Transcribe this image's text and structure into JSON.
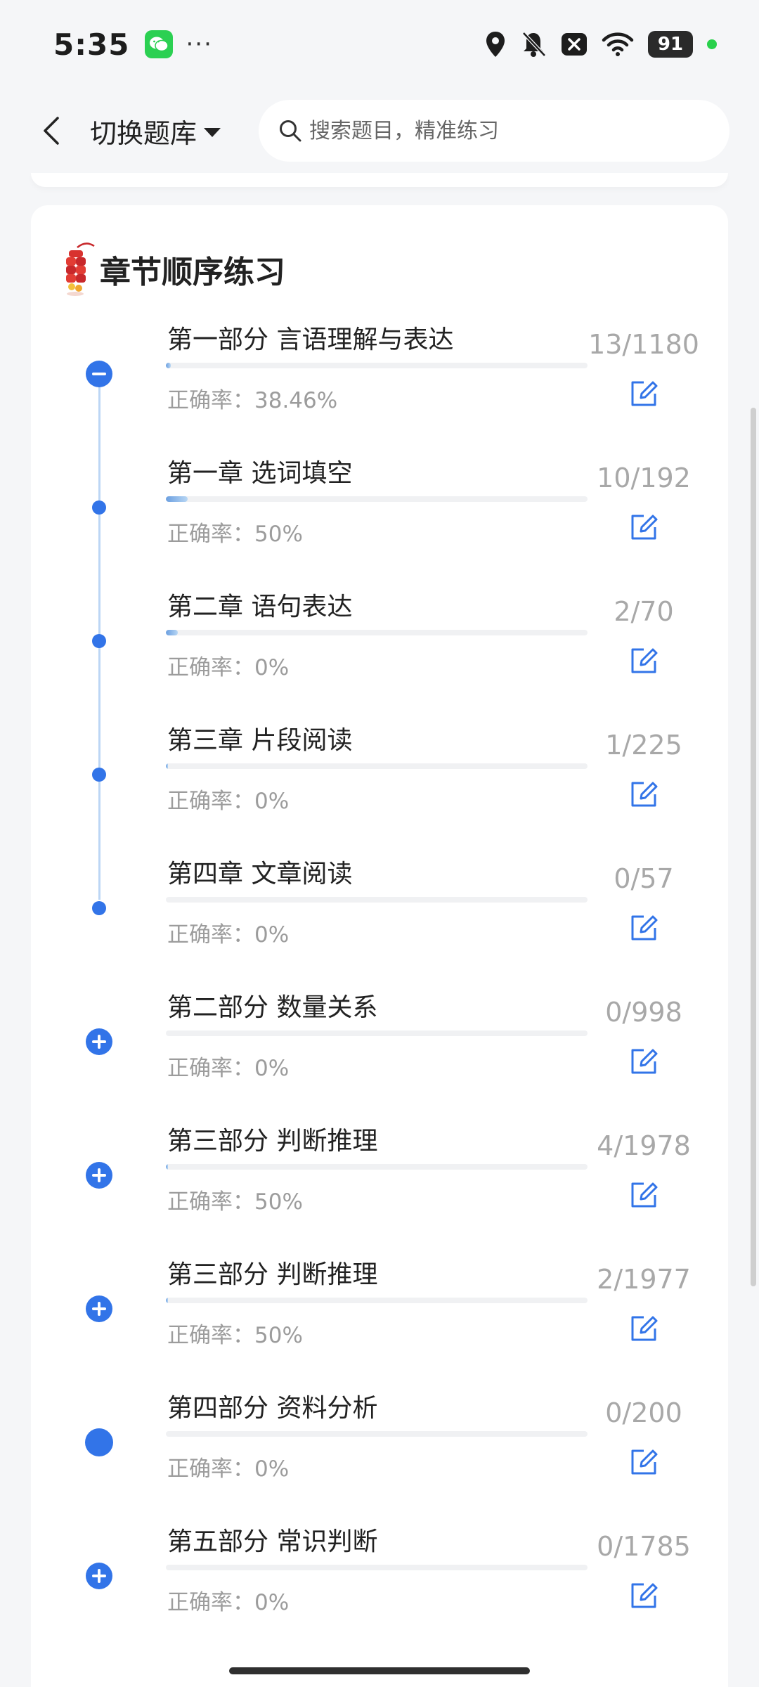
{
  "status_bar": {
    "time": "5:35",
    "more": "···",
    "battery": "91"
  },
  "header": {
    "switch_bank_label": "切换题库",
    "search_placeholder": "搜索题目，精准练习"
  },
  "section": {
    "title": "章节顺序练习"
  },
  "chapters": [
    {
      "title": "第一部分 言语理解与表达",
      "count": "13/1180",
      "accuracy": "正确率：38.46%",
      "progress": 0.011,
      "marker": "collapse"
    },
    {
      "title": "第一章 选词填空",
      "count": "10/192",
      "accuracy": "正确率：50%",
      "progress": 0.052,
      "marker": "dot"
    },
    {
      "title": "第二章 语句表达",
      "count": "2/70",
      "accuracy": "正确率：0%",
      "progress": 0.029,
      "marker": "dot"
    },
    {
      "title": "第三章 片段阅读",
      "count": "1/225",
      "accuracy": "正确率：0%",
      "progress": 0.004,
      "marker": "dot"
    },
    {
      "title": "第四章 文章阅读",
      "count": "0/57",
      "accuracy": "正确率：0%",
      "progress": 0,
      "marker": "dot"
    },
    {
      "title": "第二部分 数量关系",
      "count": "0/998",
      "accuracy": "正确率：0%",
      "progress": 0,
      "marker": "expand"
    },
    {
      "title": "第三部分 判断推理",
      "count": "4/1978",
      "accuracy": "正确率：50%",
      "progress": 0.002,
      "marker": "expand"
    },
    {
      "title": "第三部分 判断推理",
      "count": "2/1977",
      "accuracy": "正确率：50%",
      "progress": 0.001,
      "marker": "expand"
    },
    {
      "title": "第四部分 资料分析",
      "count": "0/200",
      "accuracy": "正确率：0%",
      "progress": 0,
      "marker": "full"
    },
    {
      "title": "第五部分 常识判断",
      "count": "0/1785",
      "accuracy": "正确率：0%",
      "progress": 0,
      "marker": "expand"
    }
  ],
  "colors": {
    "accent": "#3274e8",
    "timeline": "#bcd6f5",
    "muted_text": "#9c9c9c"
  },
  "icons": {
    "back": "chevron-left-icon",
    "search": "search-icon",
    "edit": "edit-icon",
    "collapse": "minus-circle-icon",
    "expand": "plus-circle-icon",
    "section": "firecracker-icon"
  }
}
